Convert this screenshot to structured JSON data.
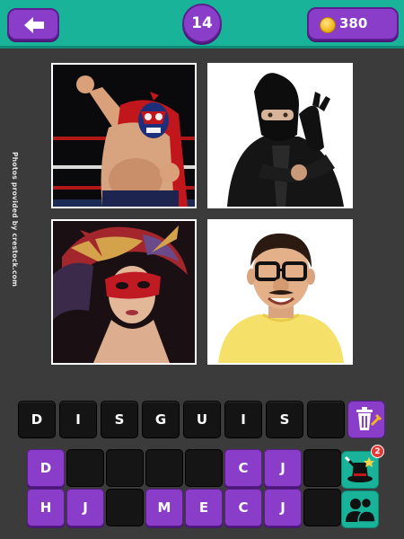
{
  "header": {
    "back_icon": "back-arrow-icon",
    "level": "14",
    "coins": "380",
    "coin_icon": "coin-icon",
    "bar_color": "#19b39a",
    "button_color": "#8a3dc9"
  },
  "credit": "Photos provided by crestock.com",
  "photos": [
    {
      "subject": "masked wrestler"
    },
    {
      "subject": "man in black balaclava"
    },
    {
      "subject": "woman with red masquerade mask"
    },
    {
      "subject": "boy with fake glasses and nose"
    }
  ],
  "answer": {
    "slots": [
      "D",
      "I",
      "S",
      "G",
      "U",
      "I",
      "S",
      ""
    ]
  },
  "letters": {
    "row1": [
      "D",
      "",
      "",
      "",
      "",
      "C",
      "J",
      ""
    ],
    "row2": [
      "H",
      "J",
      "",
      "M",
      "E",
      "C",
      "J",
      ""
    ]
  },
  "tools": {
    "remove_letters_icon": "trash-icon",
    "magic_hint_icon": "magic-hat-icon",
    "hint_count": "2",
    "ask_friends_icon": "people-icon"
  }
}
